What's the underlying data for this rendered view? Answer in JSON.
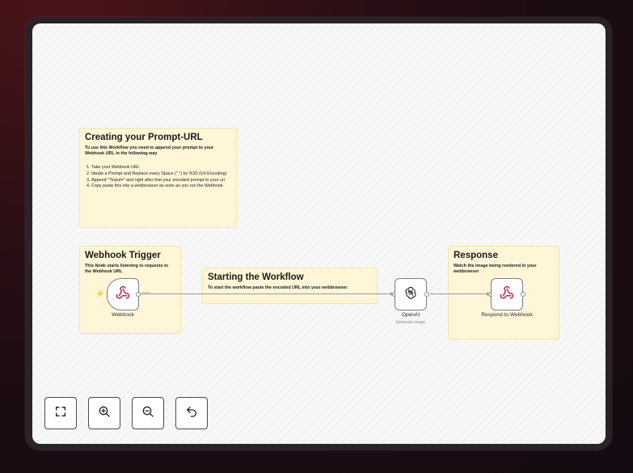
{
  "notes": {
    "prompt_url": {
      "title": "Creating your Prompt-URL",
      "subtitle": "To use this Workflow you need to append your prompt to your Webhook URL in the following way",
      "steps": [
        "Take your Webhook URL",
        "Ideate a Prompt and Replace every Space (\" \") by %20 (Url Encoding)",
        "Append \"?input=\" and right after that your encoded prompt to your url",
        "Copy paste this into a webbrowser as soon as you run the Webhook"
      ]
    },
    "webhook_trigger": {
      "title": "Webhook Trigger",
      "subtitle": "This Node starts listening to requests to the Webhook URL"
    },
    "starting": {
      "title": "Starting the Workflow",
      "subtitle": "To start the workflow paste the encoded URL into your webbrowser"
    },
    "response": {
      "title": "Response",
      "subtitle": "Watch the image being rendered in your webbrowser"
    }
  },
  "nodes": {
    "webhook": {
      "label": "Webhook",
      "icon": "webhook-icon"
    },
    "openai": {
      "label": "OpenAI",
      "sublabel": "Generate Image",
      "icon": "openai-icon"
    },
    "respond": {
      "label": "Respond to Webhook",
      "icon": "webhook-icon"
    }
  },
  "edges": {
    "get_label": "GET"
  },
  "controls": [
    {
      "name": "fit-to-view",
      "icon": "fullscreen-icon"
    },
    {
      "name": "zoom-in",
      "icon": "zoom-in-icon"
    },
    {
      "name": "zoom-out",
      "icon": "zoom-out-icon"
    },
    {
      "name": "reset",
      "icon": "undo-icon"
    }
  ],
  "colors": {
    "sticky": "#fff6d8",
    "trigger_bolt": "#ff6d5a",
    "node_border": "#7d7d85",
    "webhook_icon": "#c5264a"
  }
}
